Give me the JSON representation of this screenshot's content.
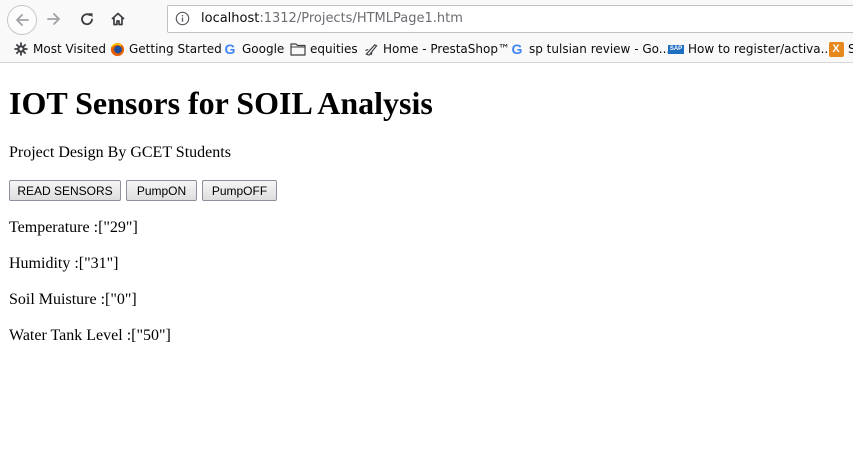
{
  "browser": {
    "url_host": "localhost",
    "url_path": ":1312/Projects/HTMLPage1.htm",
    "bookmarks": [
      {
        "label": "Most Visited",
        "icon": "gear-icon"
      },
      {
        "label": "Getting Started",
        "icon": "firefox-icon"
      },
      {
        "label": "Google",
        "icon": "google-icon"
      },
      {
        "label": "equities",
        "icon": "folder-icon"
      },
      {
        "label": "Home - PrestaShop™",
        "icon": "prestashop-icon"
      },
      {
        "label": "sp tulsian review - Go...",
        "icon": "google-icon"
      },
      {
        "label": "How to register/activa...",
        "icon": "sap-icon"
      },
      {
        "label": "S",
        "icon": "x-icon"
      }
    ]
  },
  "page": {
    "title": "IOT Sensors for SOIL Analysis",
    "subtitle": "Project Design By GCET Students",
    "buttons": {
      "read": "READ SENSORS",
      "pump_on": "PumpON",
      "pump_off": "PumpOFF"
    },
    "readings": [
      {
        "label": "Temperature :",
        "value": "[\"29\"]"
      },
      {
        "label": "Humidity :",
        "value": "[\"31\"]"
      },
      {
        "label": "Soil Muisture :",
        "value": "[\"0\"]"
      },
      {
        "label": "Water Tank Level :",
        "value": "[\"50\"]"
      }
    ]
  }
}
